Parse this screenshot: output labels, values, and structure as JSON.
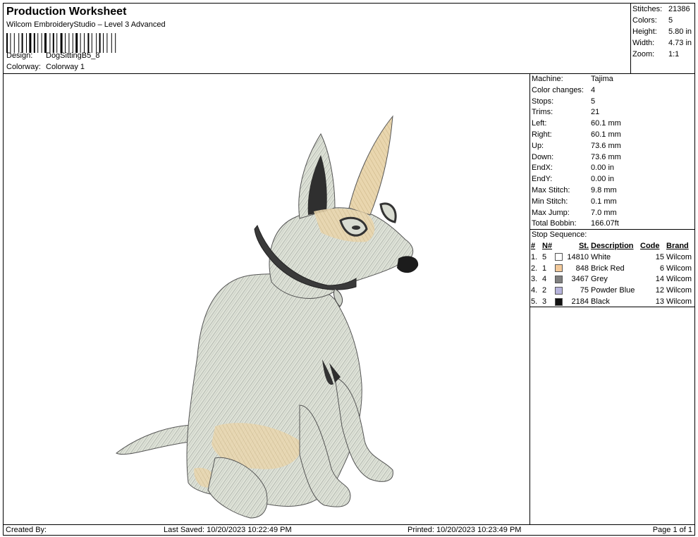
{
  "header": {
    "title": "Production Worksheet",
    "subtitle": "Wilcom EmbroideryStudio – Level 3 Advanced",
    "design_label": "Design:",
    "design_value": "DogSittingB5_8",
    "colorway_label": "Colorway:",
    "colorway_value": "Colorway 1"
  },
  "summary": {
    "stitches_label": "Stitches:",
    "stitches": "21386",
    "colors_label": "Colors:",
    "colors": "5",
    "height_label": "Height:",
    "height": "5.80 in",
    "width_label": "Width:",
    "width": "4.73 in",
    "zoom_label": "Zoom:",
    "zoom": "1:1"
  },
  "info": [
    {
      "label": "Machine:",
      "value": "Tajima"
    },
    {
      "label": "Color changes:",
      "value": "4"
    },
    {
      "label": "Stops:",
      "value": "5"
    },
    {
      "label": "Trims:",
      "value": "21"
    },
    {
      "label": "Left:",
      "value": "60.1 mm"
    },
    {
      "label": "Right:",
      "value": "60.1 mm"
    },
    {
      "label": "Up:",
      "value": "73.6 mm"
    },
    {
      "label": "Down:",
      "value": "73.6 mm"
    },
    {
      "label": "EndX:",
      "value": "0.00 in"
    },
    {
      "label": "EndY:",
      "value": "0.00 in"
    },
    {
      "label": "Max Stitch:",
      "value": "9.8 mm"
    },
    {
      "label": "Min Stitch:",
      "value": "0.1 mm"
    },
    {
      "label": "Max Jump:",
      "value": "7.0 mm"
    },
    {
      "label": "Total Bobbin:",
      "value": "166.07ft"
    }
  ],
  "stop_sequence": {
    "title": "Stop Sequence:",
    "headers": {
      "num": "#",
      "n": "N#",
      "st": "St.",
      "desc": "Description",
      "code": "Code",
      "brand": "Brand"
    },
    "rows": [
      {
        "num": "1.",
        "n": "5",
        "color": "#ffffff",
        "st": "14810",
        "desc": "White",
        "code": "15",
        "brand": "Wilcom"
      },
      {
        "num": "2.",
        "n": "1",
        "color": "#f3c99a",
        "st": "848",
        "desc": "Brick Red",
        "code": "6",
        "brand": "Wilcom"
      },
      {
        "num": "3.",
        "n": "4",
        "color": "#808080",
        "st": "3467",
        "desc": "Grey",
        "code": "14",
        "brand": "Wilcom"
      },
      {
        "num": "4.",
        "n": "2",
        "color": "#b7b4dc",
        "st": "75",
        "desc": "Powder Blue",
        "code": "12",
        "brand": "Wilcom"
      },
      {
        "num": "5.",
        "n": "3",
        "color": "#111111",
        "st": "2184",
        "desc": "Black",
        "code": "13",
        "brand": "Wilcom"
      }
    ]
  },
  "footer": {
    "created_by": "Created By:",
    "last_saved": "Last Saved: 10/20/2023 10:22:49 PM",
    "printed": "Printed: 10/20/2023 10:23:49 PM",
    "page": "Page 1 of 1"
  }
}
